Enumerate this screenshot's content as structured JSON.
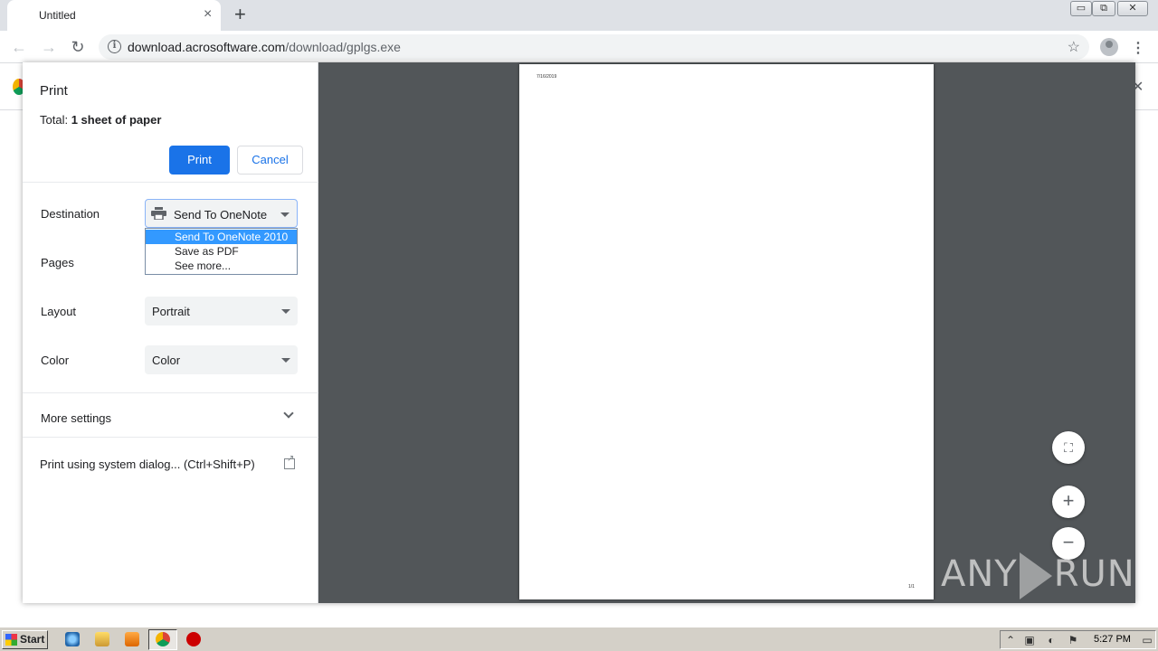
{
  "browser": {
    "tab_title": "Untitled",
    "tab_close": "×",
    "new_tab": "+",
    "url_host": "download.acrosoftware.com",
    "url_path": "/download/gplgs.exe",
    "window_controls": {
      "minimize": "▭",
      "maximize": "⧉",
      "close": "✕"
    }
  },
  "print_dialog": {
    "title": "Print",
    "total_prefix": "Total: ",
    "total_bold": "1 sheet of paper",
    "print_button": "Print",
    "cancel_button": "Cancel",
    "destination": {
      "label": "Destination",
      "value": "Send To OneNote 2010",
      "options": [
        "Send To OneNote 2010",
        "Save as PDF",
        "See more..."
      ],
      "selected_index": 0
    },
    "pages": {
      "label": "Pages"
    },
    "layout": {
      "label": "Layout",
      "value": "Portrait"
    },
    "color": {
      "label": "Color",
      "value": "Color"
    },
    "more_settings": "More settings",
    "system_dialog": "Print using system dialog... (Ctrl+Shift+P)"
  },
  "preview": {
    "sheet_date": "7/16/2019",
    "sheet_page": "1/1",
    "fit_icon": "⛶",
    "zoom_in": "+",
    "zoom_out": "−"
  },
  "watermark": {
    "left": "ANY",
    "right": "RUN"
  },
  "taskbar": {
    "start": "Start",
    "clock": "5:27 PM",
    "icons": [
      "ie-icon",
      "explorer-icon",
      "media-player-icon",
      "chrome-icon",
      "alert-icon"
    ]
  },
  "colors": {
    "accent": "#1a73e8",
    "preview_bg": "#525659",
    "dropdown_selection": "#3399ff"
  }
}
